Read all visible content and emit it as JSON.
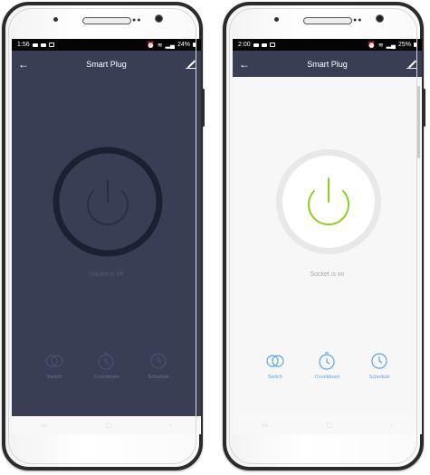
{
  "phones": [
    {
      "state": "off",
      "status_bar": {
        "time": "1:56",
        "battery": "24%"
      },
      "toolbar": {
        "title": "Smart Plug"
      },
      "socket_status": "Socket is off",
      "controls": [
        {
          "label": "Switch",
          "icon": "switch-icon"
        },
        {
          "label": "Countdown",
          "icon": "countdown-icon"
        },
        {
          "label": "Schedule",
          "icon": "schedule-icon"
        }
      ],
      "colors": {
        "screen_bg": "#393e55",
        "ring": "#1d2030",
        "power_symbol": "#2a2e40"
      }
    },
    {
      "state": "on",
      "status_bar": {
        "time": "2:00",
        "battery": "25%"
      },
      "toolbar": {
        "title": "Smart Plug"
      },
      "socket_status": "Socket is on",
      "controls": [
        {
          "label": "Switch",
          "icon": "switch-icon"
        },
        {
          "label": "Countdown",
          "icon": "countdown-icon"
        },
        {
          "label": "Schedule",
          "icon": "schedule-icon"
        }
      ],
      "colors": {
        "screen_bg": "#f7f7f7",
        "ring": "#e4e4e4",
        "power_symbol": "#8fcf1e",
        "accent": "#5aa3e8"
      }
    }
  ]
}
